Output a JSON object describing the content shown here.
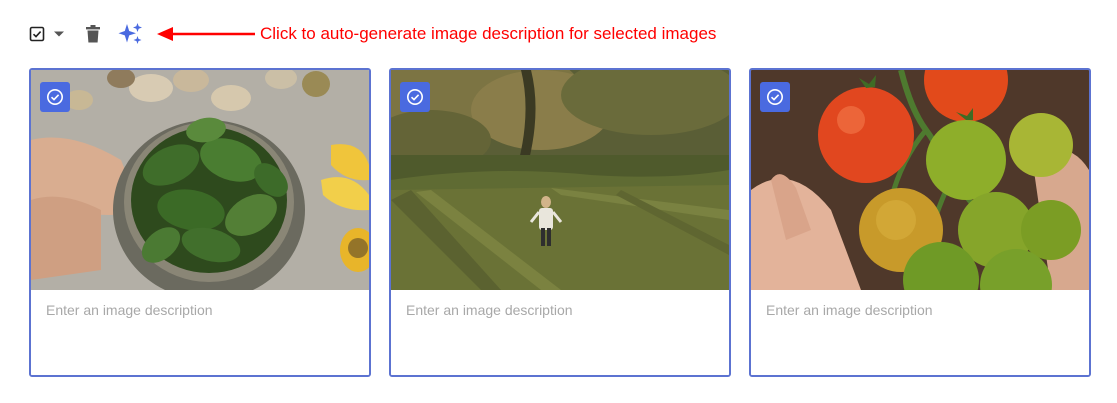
{
  "toolbar": {
    "select_icon": "checkbox-checked-icon",
    "caret_icon": "caret-down-icon",
    "delete_icon": "trash-icon",
    "generate_icon": "sparkle-icon",
    "callout_text": "Click to auto-generate image description for selected images",
    "callout_color": "#ff0000"
  },
  "cards": [
    {
      "image_subject": "bowl of spinach leaves",
      "selected": true,
      "description_value": "",
      "description_placeholder": "Enter an image description"
    },
    {
      "image_subject": "child walking in a grassy field",
      "selected": true,
      "description_value": "",
      "description_placeholder": "Enter an image description"
    },
    {
      "image_subject": "hand holding tomatoes on the vine",
      "selected": true,
      "description_value": "",
      "description_placeholder": "Enter an image description"
    }
  ],
  "colors": {
    "accent": "#4a6ae0",
    "card_border": "#5c73d1",
    "sparkle": "#4a6ae0"
  }
}
